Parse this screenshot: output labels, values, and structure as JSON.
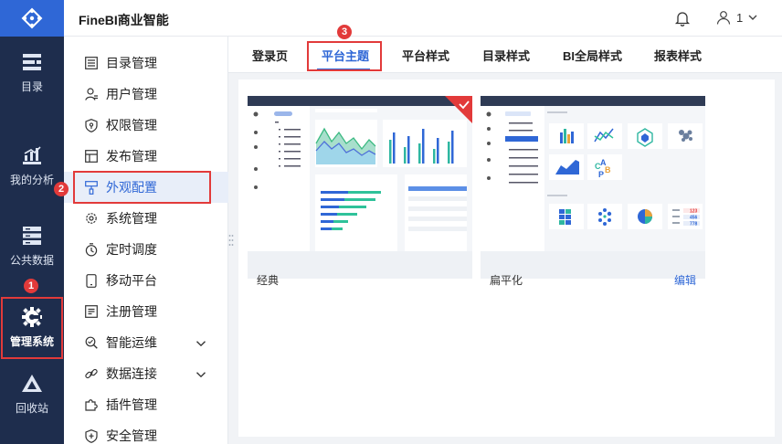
{
  "app": {
    "title": "FineBI商业智能"
  },
  "header": {
    "user_name": "1"
  },
  "rail": [
    {
      "label": "目录",
      "icon": "catalog-icon"
    },
    {
      "label": "我的分析",
      "icon": "chart-icon"
    },
    {
      "label": "公共数据",
      "icon": "database-icon"
    },
    {
      "label": "管理系统",
      "icon": "gear-icon"
    },
    {
      "label": "回收站",
      "icon": "recycle-icon"
    }
  ],
  "submenu": [
    {
      "label": "目录管理",
      "icon": "list-icon"
    },
    {
      "label": "用户管理",
      "icon": "user-icon"
    },
    {
      "label": "权限管理",
      "icon": "shield-icon"
    },
    {
      "label": "发布管理",
      "icon": "publish-icon"
    },
    {
      "label": "外观配置",
      "icon": "brush-icon"
    },
    {
      "label": "系统管理",
      "icon": "cog-icon"
    },
    {
      "label": "定时调度",
      "icon": "timer-icon"
    },
    {
      "label": "移动平台",
      "icon": "mobile-icon"
    },
    {
      "label": "注册管理",
      "icon": "register-icon"
    },
    {
      "label": "智能运维",
      "icon": "ops-icon"
    },
    {
      "label": "数据连接",
      "icon": "link-icon"
    },
    {
      "label": "插件管理",
      "icon": "plugin-icon"
    },
    {
      "label": "安全管理",
      "icon": "security-icon"
    }
  ],
  "tabs": [
    "登录页",
    "平台主题",
    "平台样式",
    "目录样式",
    "BI全局样式",
    "报表样式"
  ],
  "themes": [
    {
      "name": "经典",
      "edit": ""
    },
    {
      "name": "扁平化",
      "edit": "编辑"
    }
  ],
  "badges": {
    "one": "1",
    "two": "2",
    "three": "3"
  },
  "colors": {
    "accent": "#2f67d6",
    "rail_bg": "#1e2d4d",
    "highlight": "#e23a3a"
  }
}
